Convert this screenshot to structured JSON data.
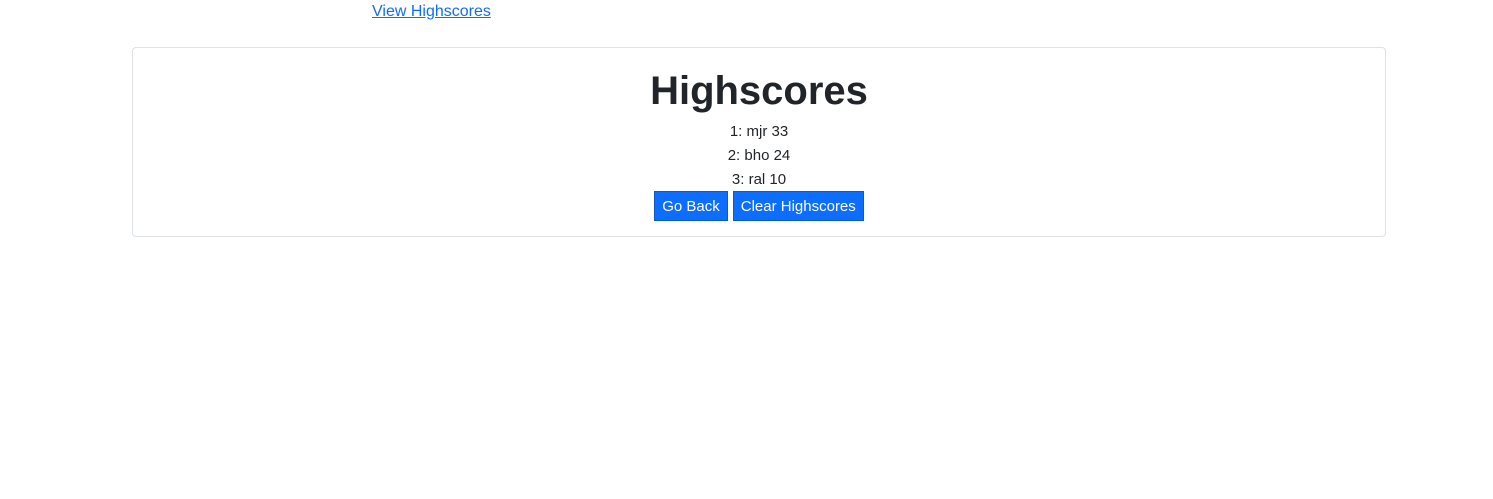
{
  "nav": {
    "view_highscores_link": "View Highscores"
  },
  "highscores": {
    "title": "Highscores",
    "entries": [
      "1: mjr 33",
      "2: bho 24",
      "3: ral 10"
    ],
    "go_back_label": "Go Back",
    "clear_label": "Clear Highscores"
  },
  "colors": {
    "primary_button": "#0d6efd",
    "link": "#0d6efd",
    "card_border": "#dee2e6",
    "text": "#212529"
  }
}
